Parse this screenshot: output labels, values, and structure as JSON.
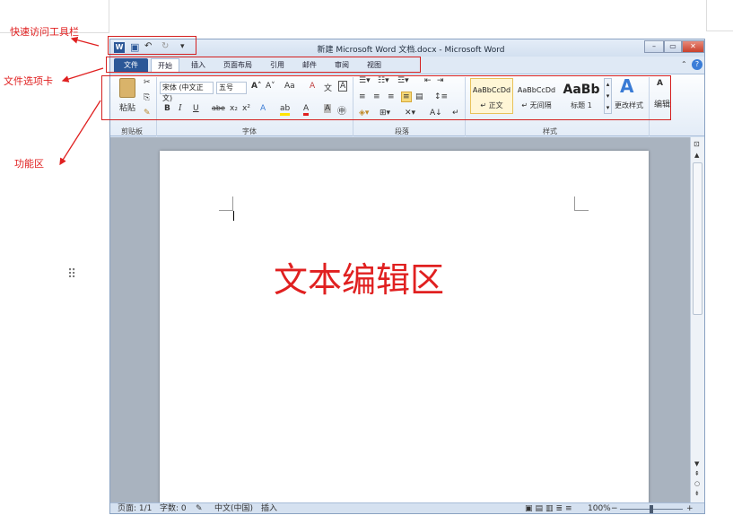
{
  "annotations": {
    "quick_access": "快速访问工具栏",
    "file_tabs": "文件选项卡",
    "ribbon": "功能区"
  },
  "window": {
    "title": "新建 Microsoft Word 文档.docx - Microsoft Word",
    "minimize": "–",
    "restore": "▭",
    "close": "✕"
  },
  "quick_access": {
    "word_logo": "W",
    "save": "▣",
    "undo": "↶",
    "redo": "↻",
    "customize": "▾"
  },
  "tabs": [
    "文件",
    "开始",
    "插入",
    "页面布局",
    "引用",
    "邮件",
    "审阅",
    "视图"
  ],
  "ribbon": {
    "clipboard": {
      "paste": "粘贴",
      "cut": "✂",
      "copy": "⎘",
      "format_painter": "✎",
      "label": "剪贴板"
    },
    "font": {
      "font_name": "宋体 (中文正文)",
      "font_size": "五号",
      "grow": "A˄",
      "shrink": "A˅",
      "case": "Aa",
      "clear": "A",
      "phonetic": "文",
      "border": "A",
      "bold": "B",
      "italic": "I",
      "underline": "U",
      "strike": "abe",
      "sub": "x₂",
      "sup": "x²",
      "effects": "A",
      "highlight": "ab",
      "color": "A",
      "shade": "A",
      "enclose": "㊥",
      "label": "字体"
    },
    "paragraph": {
      "label": "段落",
      "sort": "A↓",
      "marks": "↵"
    },
    "styles": {
      "items": [
        {
          "preview": "AaBbCcDd",
          "name": "↵ 正文"
        },
        {
          "preview": "AaBbCcDd",
          "name": "↵ 无间隔"
        },
        {
          "preview": "AaBb",
          "name": "标题 1"
        }
      ],
      "change": "更改样式",
      "label": "样式"
    },
    "editing": {
      "label": "编辑",
      "find": "A"
    }
  },
  "document": {
    "overlay_text": "文本编辑区",
    "drag_handle": "⠿"
  },
  "status": {
    "page": "页面: 1/1",
    "words": "字数: 0",
    "language": "中文(中国)",
    "mode": "插入",
    "zoom": "100%",
    "zoom_out": "−",
    "zoom_in": "+"
  },
  "colors": {
    "annotation_red": "#e02020",
    "file_tab_blue": "#2b5797"
  }
}
